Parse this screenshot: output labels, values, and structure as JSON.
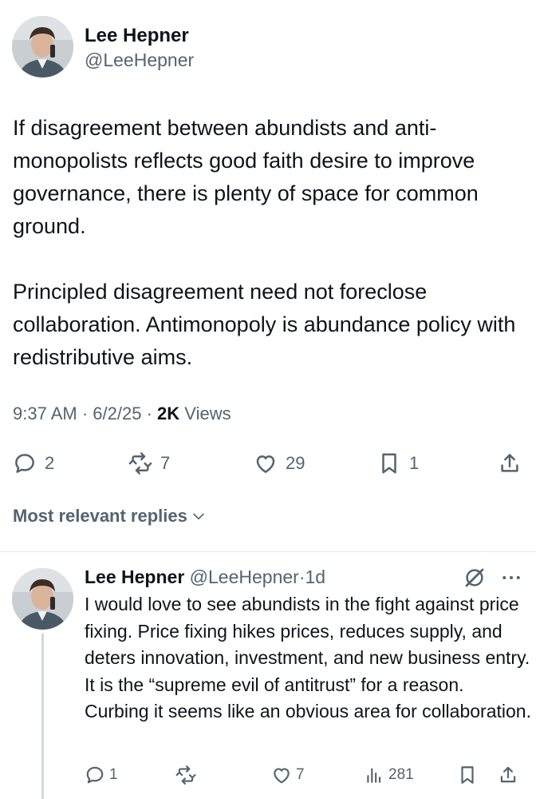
{
  "tweet": {
    "author_name": "Lee Hepner",
    "author_handle": "@LeeHepner",
    "paragraphs": [
      "If disagreement between abundists and anti-monopolists reflects good faith desire to improve governance, there is plenty of space for common ground.",
      "Principled disagreement need not foreclose collaboration. Antimonopoly is abundance policy with redistributive aims."
    ],
    "time": "9:37 AM",
    "date": "6/2/25",
    "views_count": "2K",
    "views_label": "Views",
    "separator": "·",
    "actions": {
      "replies": "2",
      "reposts": "7",
      "likes": "29",
      "bookmarks": "1"
    }
  },
  "replies_filter": {
    "label": "Most relevant replies"
  },
  "reply": {
    "author_name": "Lee Hepner",
    "author_handle": "@LeeHepner",
    "separator": "·",
    "age": "1d",
    "text": "I would love to see abundists in the fight against price fixing. Price fixing hikes prices, reduces supply, and deters innovation, investment, and new business entry. It is the “supreme evil of antitrust” for a reason. Curbing it seems like an obvious area for collaboration.",
    "actions": {
      "replies": "1",
      "likes": "7",
      "views": "281"
    }
  },
  "colors": {
    "text_primary": "#0f1419",
    "text_secondary": "#536471",
    "divider": "#e6e9eb",
    "thread_line": "#cfd9de"
  },
  "icons": [
    "reply-icon",
    "repost-icon",
    "like-icon",
    "bookmark-icon",
    "share-icon",
    "chevron-down-icon",
    "grok-icon",
    "more-icon",
    "views-icon"
  ]
}
